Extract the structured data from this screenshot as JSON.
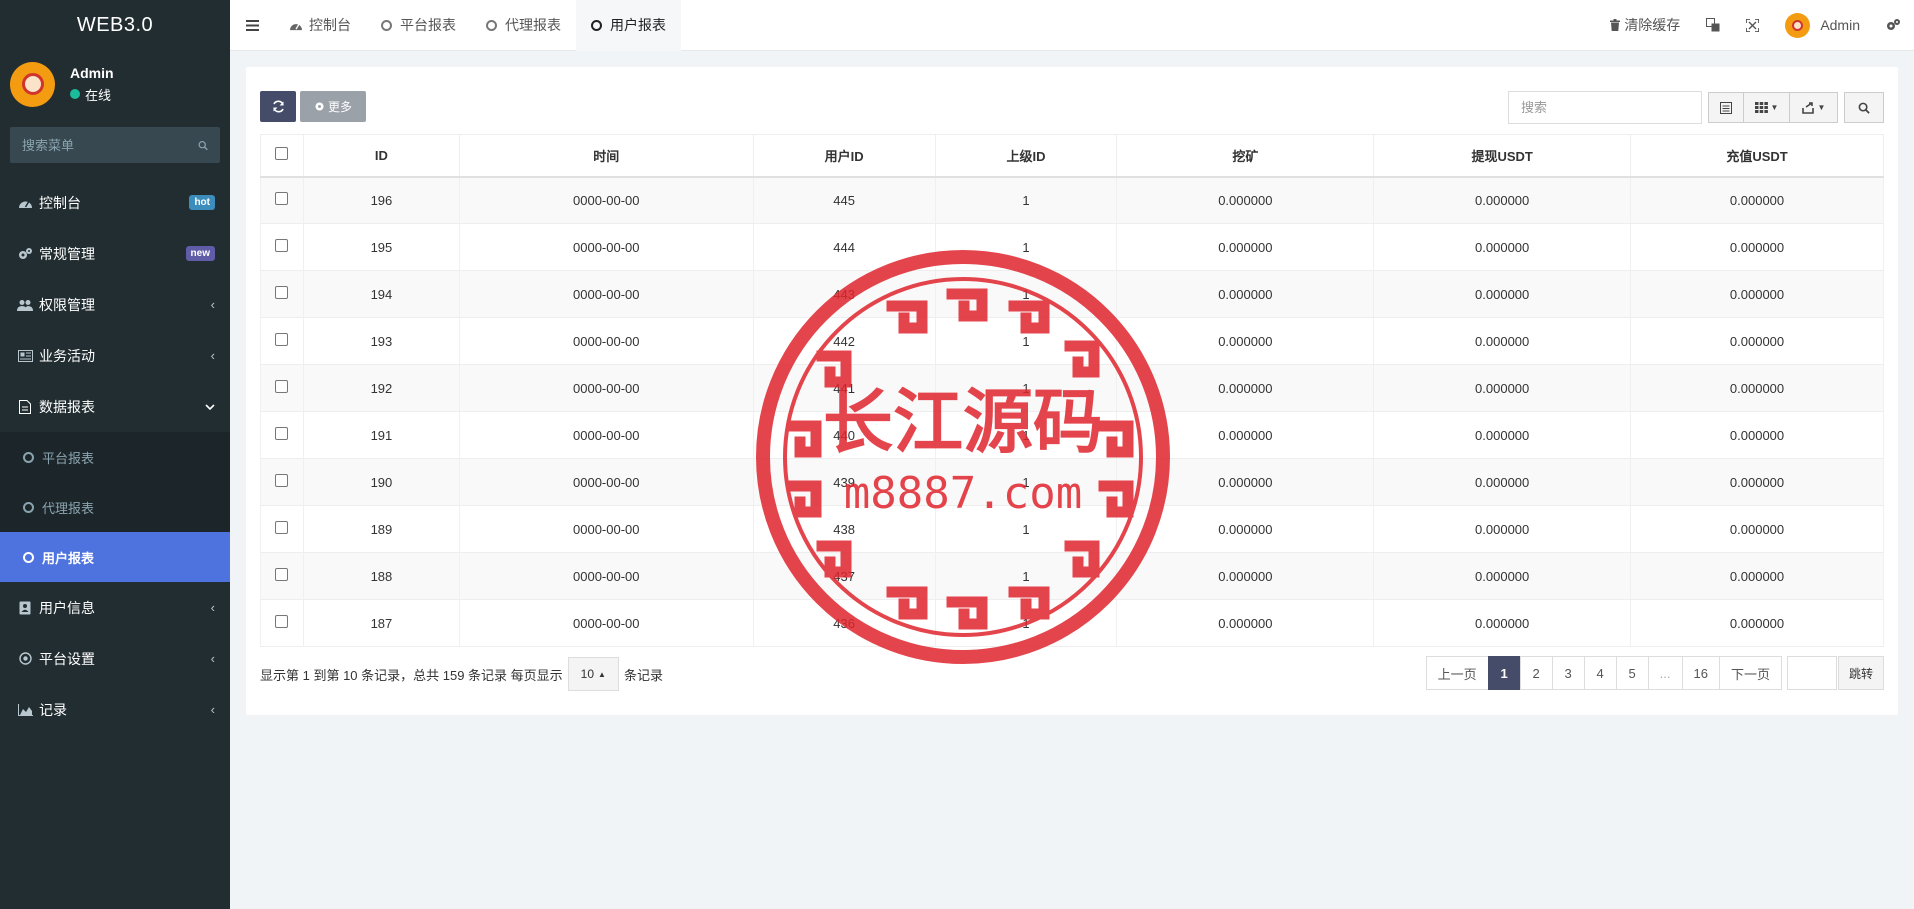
{
  "brand": "WEB3.0",
  "user": {
    "name": "Admin",
    "status": "在线"
  },
  "sidebar": {
    "search_placeholder": "搜索菜单",
    "items": [
      {
        "label": "控制台",
        "badge": "hot"
      },
      {
        "label": "常规管理",
        "badge": "new"
      },
      {
        "label": "权限管理"
      },
      {
        "label": "业务活动"
      },
      {
        "label": "数据报表"
      }
    ],
    "submenu": [
      "平台报表",
      "代理报表",
      "用户报表"
    ],
    "items_after": [
      {
        "label": "用户信息"
      },
      {
        "label": "平台设置"
      },
      {
        "label": "记录"
      }
    ]
  },
  "header": {
    "tabs": [
      "控制台",
      "平台报表",
      "代理报表",
      "用户报表"
    ],
    "clear_cache": "清除缓存",
    "admin": "Admin"
  },
  "toolbar": {
    "more_label": "更多",
    "search_placeholder": "搜索"
  },
  "table": {
    "columns": [
      "ID",
      "时间",
      "用户ID",
      "上级ID",
      "挖矿",
      "提现USDT",
      "充值USDT"
    ],
    "rows": [
      [
        "196",
        "0000-00-00",
        "445",
        "1",
        "0.000000",
        "0.000000",
        "0.000000"
      ],
      [
        "195",
        "0000-00-00",
        "444",
        "1",
        "0.000000",
        "0.000000",
        "0.000000"
      ],
      [
        "194",
        "0000-00-00",
        "443",
        "1",
        "0.000000",
        "0.000000",
        "0.000000"
      ],
      [
        "193",
        "0000-00-00",
        "442",
        "1",
        "0.000000",
        "0.000000",
        "0.000000"
      ],
      [
        "192",
        "0000-00-00",
        "441",
        "1",
        "0.000000",
        "0.000000",
        "0.000000"
      ],
      [
        "191",
        "0000-00-00",
        "440",
        "1",
        "0.000000",
        "0.000000",
        "0.000000"
      ],
      [
        "190",
        "0000-00-00",
        "439",
        "1",
        "0.000000",
        "0.000000",
        "0.000000"
      ],
      [
        "189",
        "0000-00-00",
        "438",
        "1",
        "0.000000",
        "0.000000",
        "0.000000"
      ],
      [
        "188",
        "0000-00-00",
        "437",
        "1",
        "0.000000",
        "0.000000",
        "0.000000"
      ],
      [
        "187",
        "0000-00-00",
        "436",
        "1",
        "0.000000",
        "0.000000",
        "0.000000"
      ]
    ]
  },
  "pagination": {
    "summary": "显示第 1 到第 10 条记录，总共 159 条记录 每页显示",
    "page_size": "10",
    "suffix": "条记录",
    "prev": "上一页",
    "pages": [
      "1",
      "2",
      "3",
      "4",
      "5",
      "...",
      "16"
    ],
    "next": "下一页",
    "jump": "跳转"
  },
  "watermark": {
    "title": "长江源码",
    "url": "m8887.com",
    "color": "#e0252d"
  },
  "colors": {
    "sidebar": "#222d32",
    "active": "#4e73df",
    "primary": "#444c69"
  }
}
